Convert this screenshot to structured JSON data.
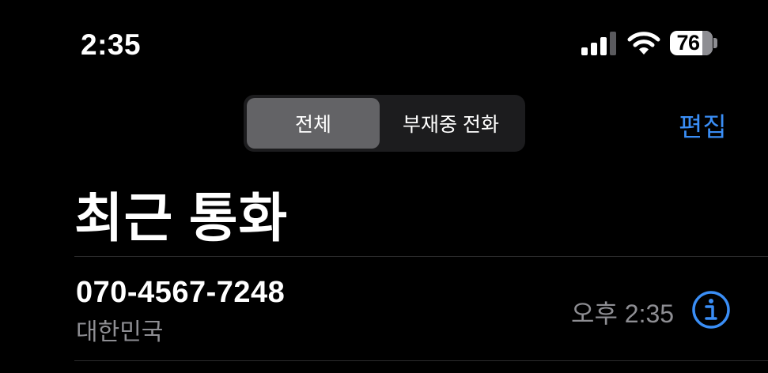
{
  "status_bar": {
    "time": "2:35",
    "battery": "76",
    "signal_icon": "cellular-signal-icon",
    "wifi_icon": "wifi-icon"
  },
  "segmented_control": {
    "selected": "전체",
    "options": [
      "전체",
      "부재중 전화"
    ]
  },
  "nav": {
    "edit_label": "편집"
  },
  "title": "최근 통화",
  "calls": [
    {
      "number": "070-4567-7248",
      "location": "대한민국",
      "time": "오후 2:35",
      "info_icon": "info-icon"
    }
  ],
  "colors": {
    "background": "#000000",
    "accent": "#3a8ef6",
    "secondary_text": "#8e8e93",
    "segment_bg": "#1c1c1e",
    "segment_selected": "#636366",
    "divider": "#2c2c2e"
  }
}
